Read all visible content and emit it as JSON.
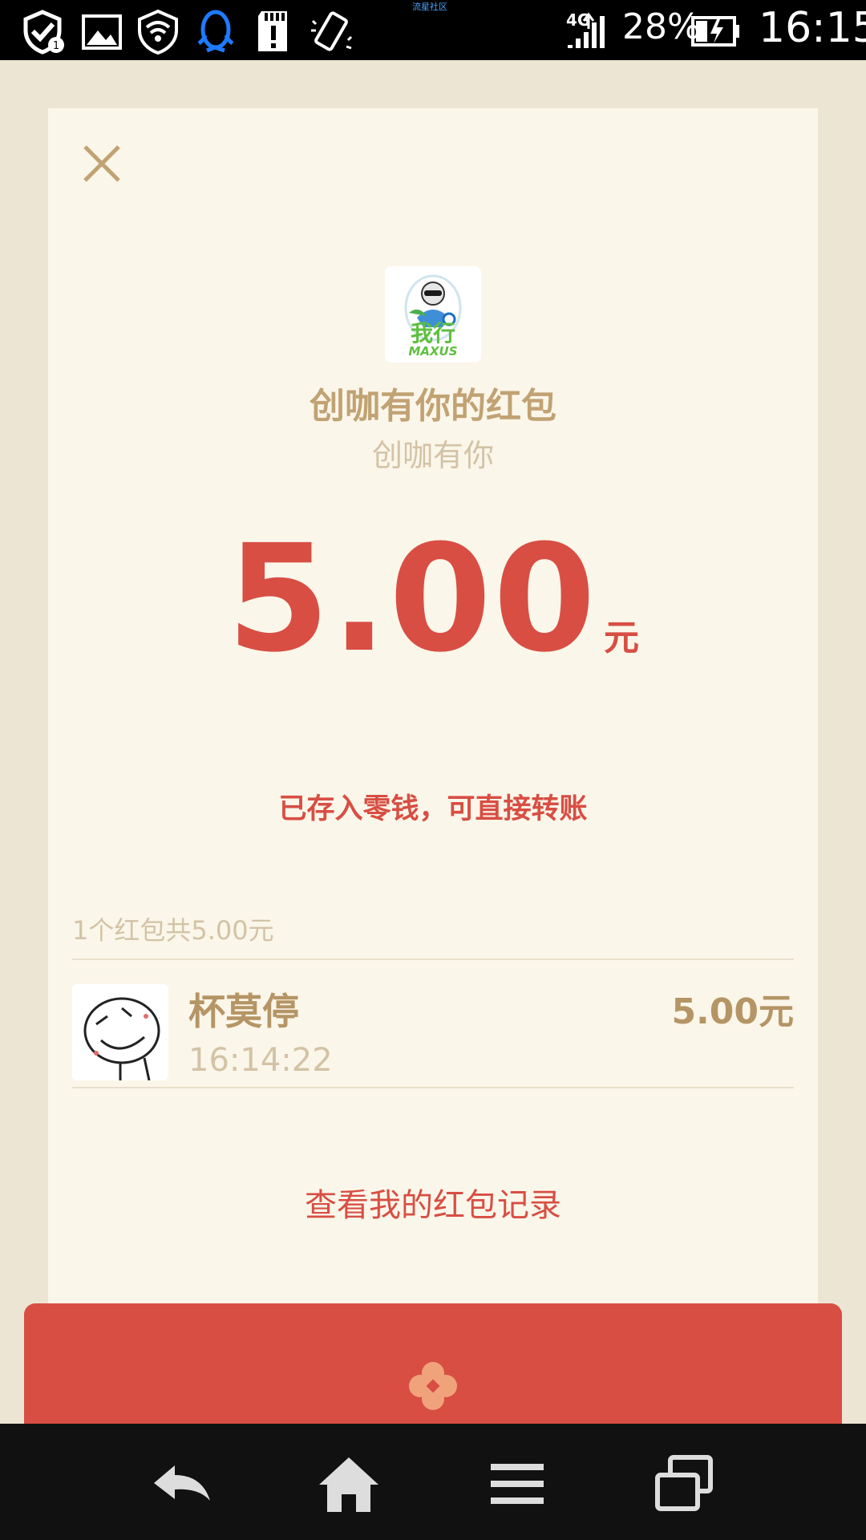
{
  "status_bar": {
    "carrier_tiny": "流星社区",
    "network": "4G",
    "battery": "28%",
    "time": "16:15",
    "icons": [
      "shield-check-icon",
      "image-icon",
      "wifi-shield-icon",
      "qq-penguin-icon",
      "sd-card-alert-icon",
      "rotate-icon",
      "signal-icon",
      "battery-charging-icon"
    ]
  },
  "packet": {
    "logo_text": "我行",
    "logo_sub": "MAXUS",
    "title": "创咖有你的红包",
    "subtitle": "创咖有你",
    "amount": "5.00",
    "amount_unit": "元",
    "deposit_note": "已存入零钱，可直接转账"
  },
  "records": {
    "summary": "1个红包共5.00元",
    "items": [
      {
        "name": "杯莫停",
        "time": "16:14:22",
        "amount": "5.00元"
      }
    ]
  },
  "history_link": "查看我的红包记录",
  "colors": {
    "accent_red": "#d84e43",
    "gold": "#c1a273",
    "card_bg": "#fbf6ea",
    "page_bg": "#ece5d3"
  },
  "nav": [
    "back-icon",
    "home-icon",
    "menu-icon",
    "recent-apps-icon"
  ]
}
